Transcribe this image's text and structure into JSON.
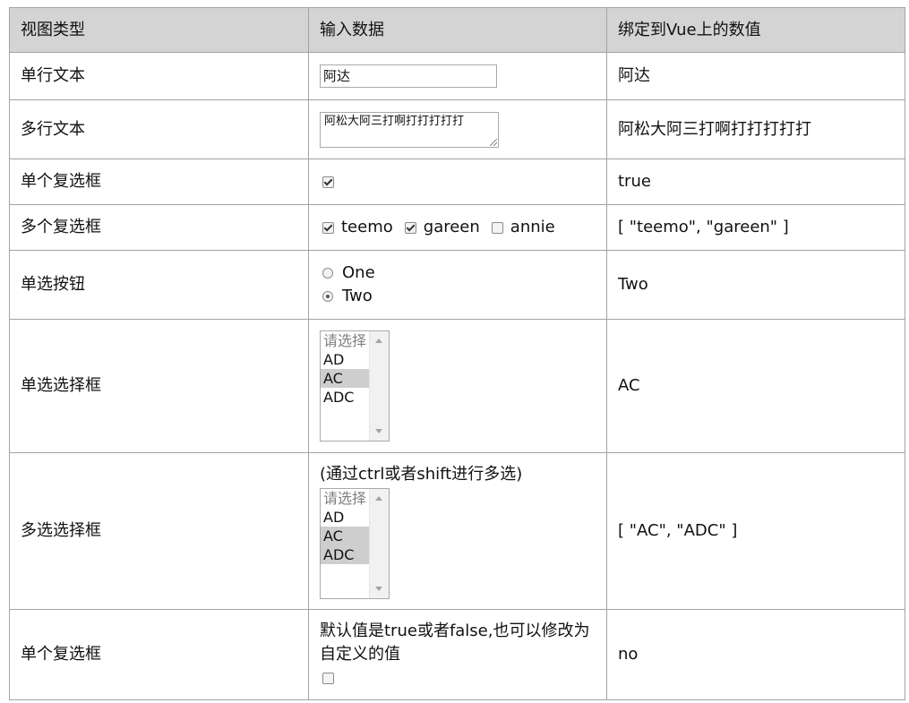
{
  "headers": [
    "视图类型",
    "输入数据",
    "绑定到Vue上的数值"
  ],
  "rows": {
    "single_text": {
      "label": "单行文本",
      "input_value": "阿达",
      "bound": "阿达"
    },
    "multi_text": {
      "label": "多行文本",
      "textarea_value": "阿松大阿三打啊打打打打打",
      "bound": "阿松大阿三打啊打打打打打"
    },
    "single_checkbox": {
      "label": "单个复选框",
      "checked": true,
      "bound": "true"
    },
    "multi_checkbox": {
      "label": "多个复选框",
      "options": [
        {
          "label": "teemo",
          "checked": true
        },
        {
          "label": "gareen",
          "checked": true
        },
        {
          "label": "annie",
          "checked": false
        }
      ],
      "bound": "[ \"teemo\", \"gareen\" ]"
    },
    "radio": {
      "label": "单选按钮",
      "options": [
        {
          "label": "One",
          "checked": false
        },
        {
          "label": "Two",
          "checked": true
        }
      ],
      "bound": "Two"
    },
    "single_select": {
      "label": "单选选择框",
      "options": [
        "请选择",
        "AD",
        "AC",
        "ADC"
      ],
      "selected": [
        "AC"
      ],
      "bound": "AC"
    },
    "multi_select": {
      "label": "多选选择框",
      "hint": "(通过ctrl或者shift进行多选)",
      "options": [
        "请选择",
        "AD",
        "AC",
        "ADC"
      ],
      "selected": [
        "AC",
        "ADC"
      ],
      "bound": "[ \"AC\", \"ADC\" ]"
    },
    "custom_checkbox": {
      "label": "单个复选框",
      "hint": "默认值是true或者false,也可以修改为自定义的值",
      "checked": false,
      "bound": "no"
    }
  }
}
